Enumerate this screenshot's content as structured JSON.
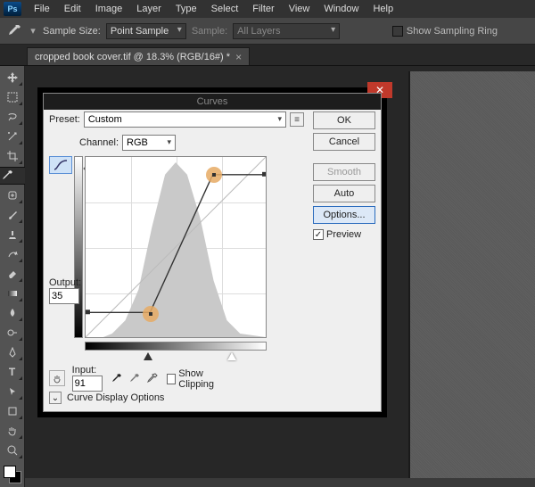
{
  "menu": {
    "items": [
      "File",
      "Edit",
      "Image",
      "Layer",
      "Type",
      "Select",
      "Filter",
      "View",
      "Window",
      "Help"
    ]
  },
  "options_bar": {
    "sample_size_label": "Sample Size:",
    "sample_size_value": "Point Sample",
    "sample_label": "Sample:",
    "sample_value": "All Layers",
    "show_ring": "Show Sampling Ring"
  },
  "tab": {
    "title": "cropped book cover.tif @ 18.3% (RGB/16#) *"
  },
  "dialog": {
    "title": "Curves",
    "preset_label": "Preset:",
    "preset_value": "Custom",
    "channel_label": "Channel:",
    "channel_value": "RGB",
    "output_label": "Output:",
    "output_value": "35",
    "input_label": "Input:",
    "input_value": "91",
    "show_clipping": "Show Clipping",
    "expand": "Curve Display Options",
    "buttons": {
      "ok": "OK",
      "cancel": "Cancel",
      "smooth": "Smooth",
      "auto": "Auto",
      "options": "Options..."
    },
    "preview": "Preview"
  },
  "chart_data": {
    "type": "line",
    "title": "Curves",
    "xlabel": "Input",
    "ylabel": "Output",
    "xlim": [
      0,
      255
    ],
    "ylim": [
      0,
      255
    ],
    "points": [
      {
        "input": 0,
        "output": 35
      },
      {
        "input": 91,
        "output": 35
      },
      {
        "input": 180,
        "output": 230
      },
      {
        "input": 255,
        "output": 230
      }
    ],
    "selected_point": {
      "input": 91,
      "output": 35
    },
    "highlighted_points": [
      {
        "input": 91,
        "output": 35
      },
      {
        "input": 180,
        "output": 230
      }
    ]
  }
}
